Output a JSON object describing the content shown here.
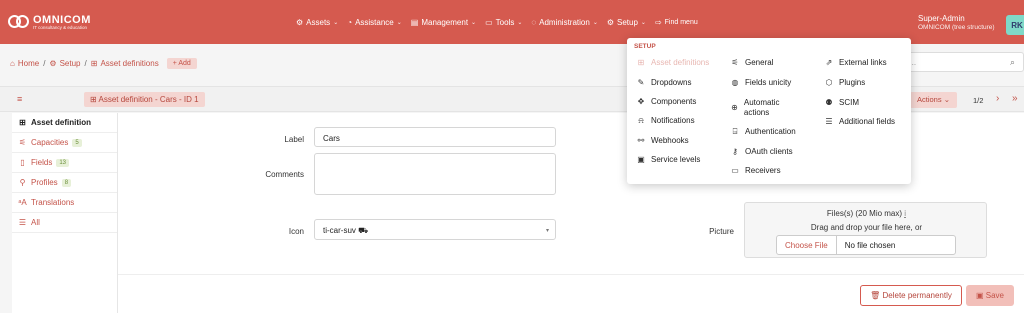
{
  "brand": {
    "name": "OMNICOM",
    "tagline": "IT consultancy & education"
  },
  "nav": {
    "items": [
      {
        "icon": "assets-icon",
        "glyph": "⚙",
        "label": "Assets"
      },
      {
        "icon": "assistance-icon",
        "glyph": "◔",
        "label": "Assistance"
      },
      {
        "icon": "management-icon",
        "glyph": "▤",
        "label": "Management"
      },
      {
        "icon": "tools-icon",
        "glyph": "▭",
        "label": "Tools"
      },
      {
        "icon": "administration-icon",
        "glyph": "◌",
        "label": "Administration"
      },
      {
        "icon": "setup-icon",
        "glyph": "⚙",
        "label": "Setup"
      }
    ],
    "find_menu": "Find menu"
  },
  "user": {
    "name": "Super-Admin",
    "entity": "OMNICOM (tree structure)",
    "initials": "RK"
  },
  "breadcrumb": {
    "home": "Home",
    "setup": "Setup",
    "current": "Asset definitions",
    "add_label": "+ Add"
  },
  "search": {
    "placeholder": "h..."
  },
  "card": {
    "title": "Asset definition - Cars - ID 1",
    "actions_label": "Actions",
    "pager": "1/2"
  },
  "sidebar": {
    "items": [
      {
        "label": "Asset definition",
        "count": null
      },
      {
        "label": "Capacities",
        "count": "5"
      },
      {
        "label": "Fields",
        "count": "13"
      },
      {
        "label": "Profiles",
        "count": "8"
      },
      {
        "label": "Translations",
        "count": null
      },
      {
        "label": "All",
        "count": null
      }
    ]
  },
  "form": {
    "label_label": "Label",
    "label_value": "Cars",
    "comments_label": "Comments",
    "comments_value": "",
    "icon_label": "Icon",
    "icon_value": "ti-car-suv",
    "picture_label": "Picture",
    "picture_limit": "Files(s) (20 Mio max)",
    "picture_limit_hint": "i",
    "drop_hint": "Drag and drop your file here, or",
    "choose_file": "Choose File",
    "no_file": "No file chosen",
    "delete_label": "Delete permanently",
    "save_label": "Save"
  },
  "setup_menu": {
    "heading": "SETUP",
    "col1": [
      {
        "label": "Asset definitions",
        "glyph": "⊞",
        "disabled": true
      },
      {
        "label": "Dropdowns",
        "glyph": "✎",
        "disabled": false
      },
      {
        "label": "Components",
        "glyph": "✥",
        "disabled": false
      },
      {
        "label": "Notifications",
        "glyph": "⍾",
        "disabled": false
      },
      {
        "label": "Webhooks",
        "glyph": "⚯",
        "disabled": false
      },
      {
        "label": "Service levels",
        "glyph": "▣",
        "disabled": false
      }
    ],
    "col2": [
      {
        "label": "General",
        "glyph": "⚟"
      },
      {
        "label": "Fields unicity",
        "glyph": "◍"
      },
      {
        "label": "Automatic actions",
        "glyph": "⊕"
      },
      {
        "label": "Authentication",
        "glyph": "⍈"
      },
      {
        "label": "OAuth clients",
        "glyph": "⚷"
      },
      {
        "label": "Receivers",
        "glyph": "▭"
      }
    ],
    "col3": [
      {
        "label": "External links",
        "glyph": "⇗"
      },
      {
        "label": "Plugins",
        "glyph": "⬡"
      },
      {
        "label": "SCIM",
        "glyph": "⚉"
      },
      {
        "label": "Additional fields",
        "glyph": "☰"
      }
    ]
  },
  "colors": {
    "accent": "#d55a4f",
    "accent_light": "#f4d5d1",
    "avatar": "#7fd9c8"
  }
}
